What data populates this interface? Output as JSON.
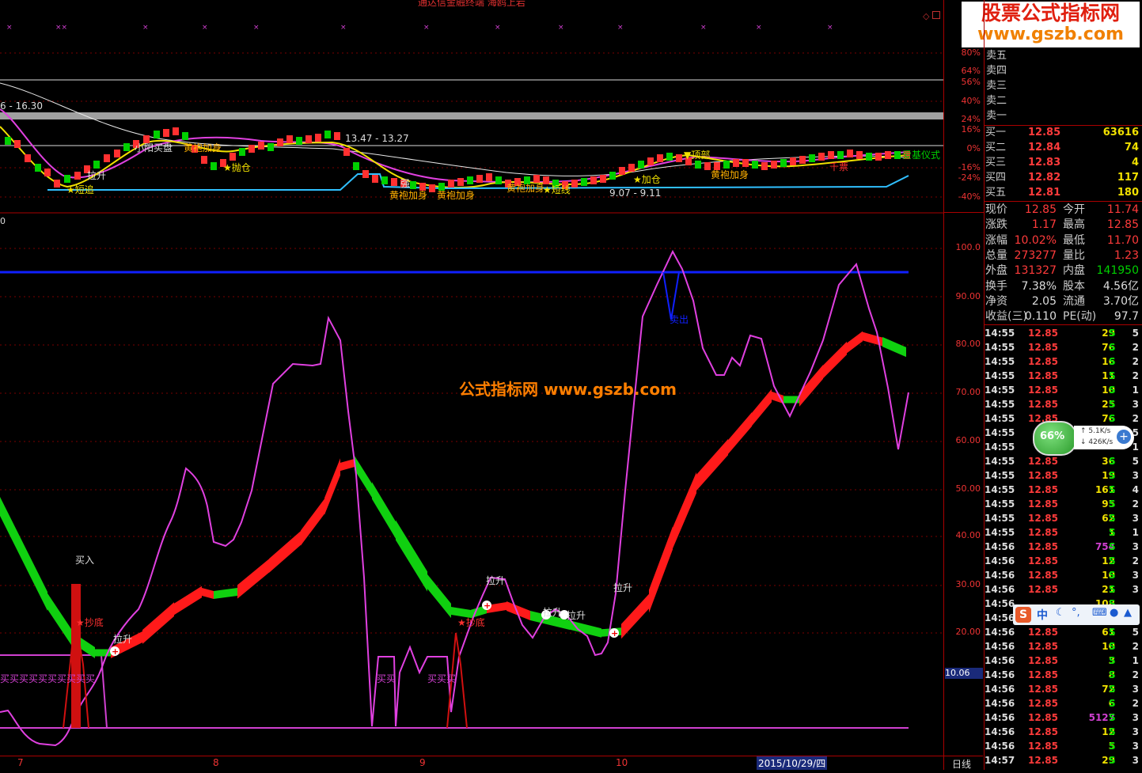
{
  "window": {
    "title": "通达信金融终端  海鸥上岩",
    "corner_icons": [
      "diamond-icon",
      "restore-icon"
    ]
  },
  "logo": {
    "line1": "股票公式指标网",
    "line2": "www.gszb.com"
  },
  "watermark": "公式指标网  www.gszb.com",
  "upper_chart": {
    "price_labels": {
      "top": "6 - 16.30",
      "mid": "13.47 - 13.27",
      "low": "9.07 - 9.11"
    },
    "axis_pct": [
      "80%",
      "64%",
      "56%",
      "40%",
      "24%",
      "16%",
      "0%",
      "-16%",
      "-24%",
      "-40%"
    ],
    "signals": [
      "小阳买盘",
      "黄袍加身",
      "拉升",
      "抛仓",
      "短追",
      "强",
      "黄袍加身",
      "黄袍加身",
      "黄袍加身",
      "短线",
      "顶部",
      "加仓",
      "黄袍加身",
      "千票",
      "爱基仪式"
    ]
  },
  "lower_chart": {
    "zero_label": "0",
    "axis_values": [
      "100.0",
      "90.00",
      "80.00",
      "70.00",
      "60.00",
      "50.00",
      "40.00",
      "30.00",
      "20.00"
    ],
    "current_value": "10.06",
    "annotations": {
      "buy": "买入",
      "bottom1": "★抄底",
      "bottom2": "★抄底",
      "rise": "拉升",
      "sell": "卖出",
      "buy_band": "买买买买买买买买买买",
      "buy_small1": "买买",
      "buy_small2": "买买买"
    }
  },
  "bottom_bar": {
    "months": [
      "7",
      "8",
      "9",
      "10"
    ],
    "date": "2015/10/29/四",
    "period": "日线"
  },
  "quote": {
    "asks": [
      {
        "label": "卖五",
        "price": "",
        "vol": ""
      },
      {
        "label": "卖四",
        "price": "",
        "vol": ""
      },
      {
        "label": "卖三",
        "price": "",
        "vol": ""
      },
      {
        "label": "卖二",
        "price": "",
        "vol": ""
      },
      {
        "label": "卖一",
        "price": "",
        "vol": ""
      }
    ],
    "bids": [
      {
        "label": "买一",
        "price": "12.85",
        "vol": "63616"
      },
      {
        "label": "买二",
        "price": "12.84",
        "vol": "74"
      },
      {
        "label": "买三",
        "price": "12.83",
        "vol": "4"
      },
      {
        "label": "买四",
        "price": "12.82",
        "vol": "117"
      },
      {
        "label": "买五",
        "price": "12.81",
        "vol": "180"
      }
    ],
    "stats": [
      {
        "l1": "现价",
        "v1": "12.85",
        "l2": "今开",
        "v2": "11.74"
      },
      {
        "l1": "涨跌",
        "v1": "1.17",
        "l2": "最高",
        "v2": "12.85"
      },
      {
        "l1": "涨幅",
        "v1": "10.02%",
        "l2": "最低",
        "v2": "11.70"
      },
      {
        "l1": "总量",
        "v1": "273277",
        "l2": "量比",
        "v2": "1.23"
      },
      {
        "l1": "外盘",
        "v1": "131327",
        "l2": "内盘",
        "v2": "141950"
      },
      {
        "l1": "换手",
        "v1": "7.38%",
        "l2": "股本",
        "v2": "4.56亿"
      },
      {
        "l1": "净资",
        "v1": "2.05",
        "l2": "流通",
        "v2": "3.70亿"
      },
      {
        "l1": "收益(三)",
        "v1": "0.110",
        "l2": "PE(动)",
        "v2": "97.7"
      }
    ],
    "ticks": [
      {
        "t": "14:55",
        "p": "12.85",
        "v": "29",
        "bs": "S",
        "n": "5"
      },
      {
        "t": "14:55",
        "p": "12.85",
        "v": "76",
        "bs": "S",
        "n": "2"
      },
      {
        "t": "14:55",
        "p": "12.85",
        "v": "16",
        "bs": "S",
        "n": "2"
      },
      {
        "t": "14:55",
        "p": "12.85",
        "v": "11",
        "bs": "S",
        "n": "2"
      },
      {
        "t": "14:55",
        "p": "12.85",
        "v": "10",
        "bs": "S",
        "n": "1"
      },
      {
        "t": "14:55",
        "p": "12.85",
        "v": "25",
        "bs": "S",
        "n": "3"
      },
      {
        "t": "14:55",
        "p": "12.85",
        "v": "76",
        "bs": "S",
        "n": "2"
      },
      {
        "t": "14:55",
        "p": "",
        "v": "",
        "bs": "",
        "n": "5"
      },
      {
        "t": "14:55",
        "p": "",
        "v": "",
        "bs": "",
        "n": "1"
      },
      {
        "t": "14:55",
        "p": "12.85",
        "v": "36",
        "bs": "S",
        "n": "5"
      },
      {
        "t": "14:55",
        "p": "12.85",
        "v": "19",
        "bs": "S",
        "n": "3"
      },
      {
        "t": "14:55",
        "p": "12.85",
        "v": "161",
        "bs": "S",
        "n": "4"
      },
      {
        "t": "14:55",
        "p": "12.85",
        "v": "95",
        "bs": "S",
        "n": "2"
      },
      {
        "t": "14:55",
        "p": "12.85",
        "v": "62",
        "bs": "S",
        "n": "3"
      },
      {
        "t": "14:55",
        "p": "12.85",
        "v": "1",
        "bs": "S",
        "n": "1"
      },
      {
        "t": "14:56",
        "p": "12.85",
        "v": "754",
        "bs": "S",
        "n": "3"
      },
      {
        "t": "14:56",
        "p": "12.85",
        "v": "12",
        "bs": "S",
        "n": "2"
      },
      {
        "t": "14:56",
        "p": "12.85",
        "v": "10",
        "bs": "S",
        "n": "3"
      },
      {
        "t": "14:56",
        "p": "12.85",
        "v": "21",
        "bs": "S",
        "n": "3"
      },
      {
        "t": "14:56",
        "p": "",
        "v": "108",
        "bs": "S",
        "n": ""
      },
      {
        "t": "14:56",
        "p": "",
        "v": "",
        "bs": "",
        "n": ""
      },
      {
        "t": "14:56",
        "p": "12.85",
        "v": "61",
        "bs": "S",
        "n": "5"
      },
      {
        "t": "14:56",
        "p": "12.85",
        "v": "10",
        "bs": "S",
        "n": "2"
      },
      {
        "t": "14:56",
        "p": "12.85",
        "v": "3",
        "bs": "S",
        "n": "1"
      },
      {
        "t": "14:56",
        "p": "12.85",
        "v": "8",
        "bs": "S",
        "n": "2"
      },
      {
        "t": "14:56",
        "p": "12.85",
        "v": "72",
        "bs": "S",
        "n": "3"
      },
      {
        "t": "14:56",
        "p": "12.85",
        "v": "6",
        "bs": "S",
        "n": "2"
      },
      {
        "t": "14:56",
        "p": "12.85",
        "v": "5127",
        "bs": "S",
        "n": "3"
      },
      {
        "t": "14:56",
        "p": "12.85",
        "v": "12",
        "bs": "S",
        "n": "3"
      },
      {
        "t": "14:56",
        "p": "12.85",
        "v": "5",
        "bs": "S",
        "n": "3"
      },
      {
        "t": "14:57",
        "p": "12.85",
        "v": "29",
        "bs": "S",
        "n": "3"
      }
    ]
  },
  "speed_widget": {
    "percent": "66%",
    "up": "5.1K/s",
    "down": "426K/s"
  },
  "ime_bar": {
    "label": "中"
  },
  "colors": {
    "up": "#ff2020",
    "down": "#00d000",
    "magenta": "#e040e0",
    "blue": "#1020ff",
    "cyan": "#30c0ff"
  }
}
